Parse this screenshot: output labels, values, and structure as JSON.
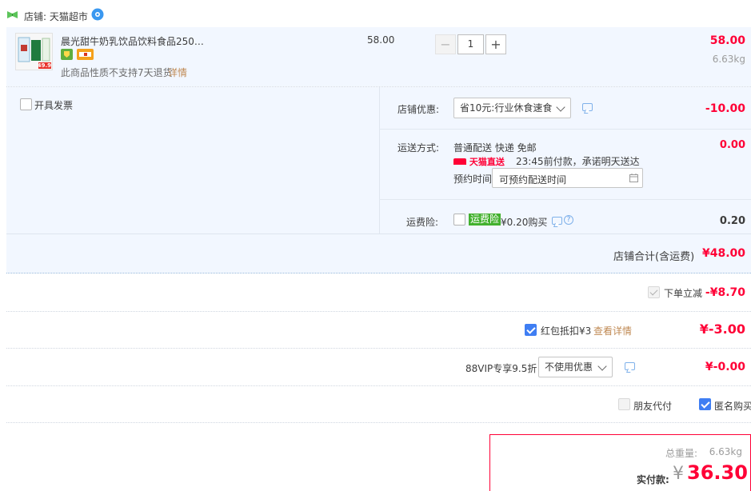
{
  "shop": {
    "label": "店铺: 天猫超市"
  },
  "item": {
    "title": "晨光甜牛奶乳饮品饮料食品250…",
    "unit_price": "58.00",
    "quantity": "1",
    "subtotal": "58.00",
    "weight": "6.63kg",
    "return_note": "此商品性质不支持7天退货",
    "detail_link": "详情",
    "thumb_price_tag": "49.9"
  },
  "invoice": {
    "label": "开具发票"
  },
  "shop_discount": {
    "label": "店铺优惠:",
    "selected": "省10元:行业休食速食",
    "amount": "-10.00"
  },
  "shipping": {
    "label": "运送方式:",
    "method": "普通配送 快递 免邮",
    "amount": "0.00",
    "badge": "天猫直送",
    "promise": "23:45前付款，承诺明天送达",
    "schedule_label": "预约时间",
    "schedule_placeholder": "可预约配送时间"
  },
  "insurance": {
    "label": "运费险:",
    "tag": "运费险",
    "price": "¥0.20购买",
    "amount": "0.20"
  },
  "shop_total": {
    "label": "店铺合计(含运费)",
    "amount": "¥48.00"
  },
  "instant_discount": {
    "label": "下单立减",
    "amount": "-¥8.70"
  },
  "red_packet": {
    "label": "红包抵扣¥3",
    "link": "查看详情",
    "amount": "¥-3.00"
  },
  "vip": {
    "label": "88VIP专享9.5折",
    "selected": "不使用优惠",
    "amount": "¥-0.00"
  },
  "options": {
    "friend_pay": "朋友代付",
    "anonymous": "匿名购买"
  },
  "summary": {
    "weight_label": "总重量:",
    "weight": "6.63kg",
    "pay_label": "实付款:",
    "currency": "¥",
    "total": "36.30"
  },
  "colors": {
    "accent_red": "#ff0036",
    "blue_bg": "#f2f7ff",
    "link_orange": "#c08a54",
    "check_blue": "#3f7ef3"
  }
}
